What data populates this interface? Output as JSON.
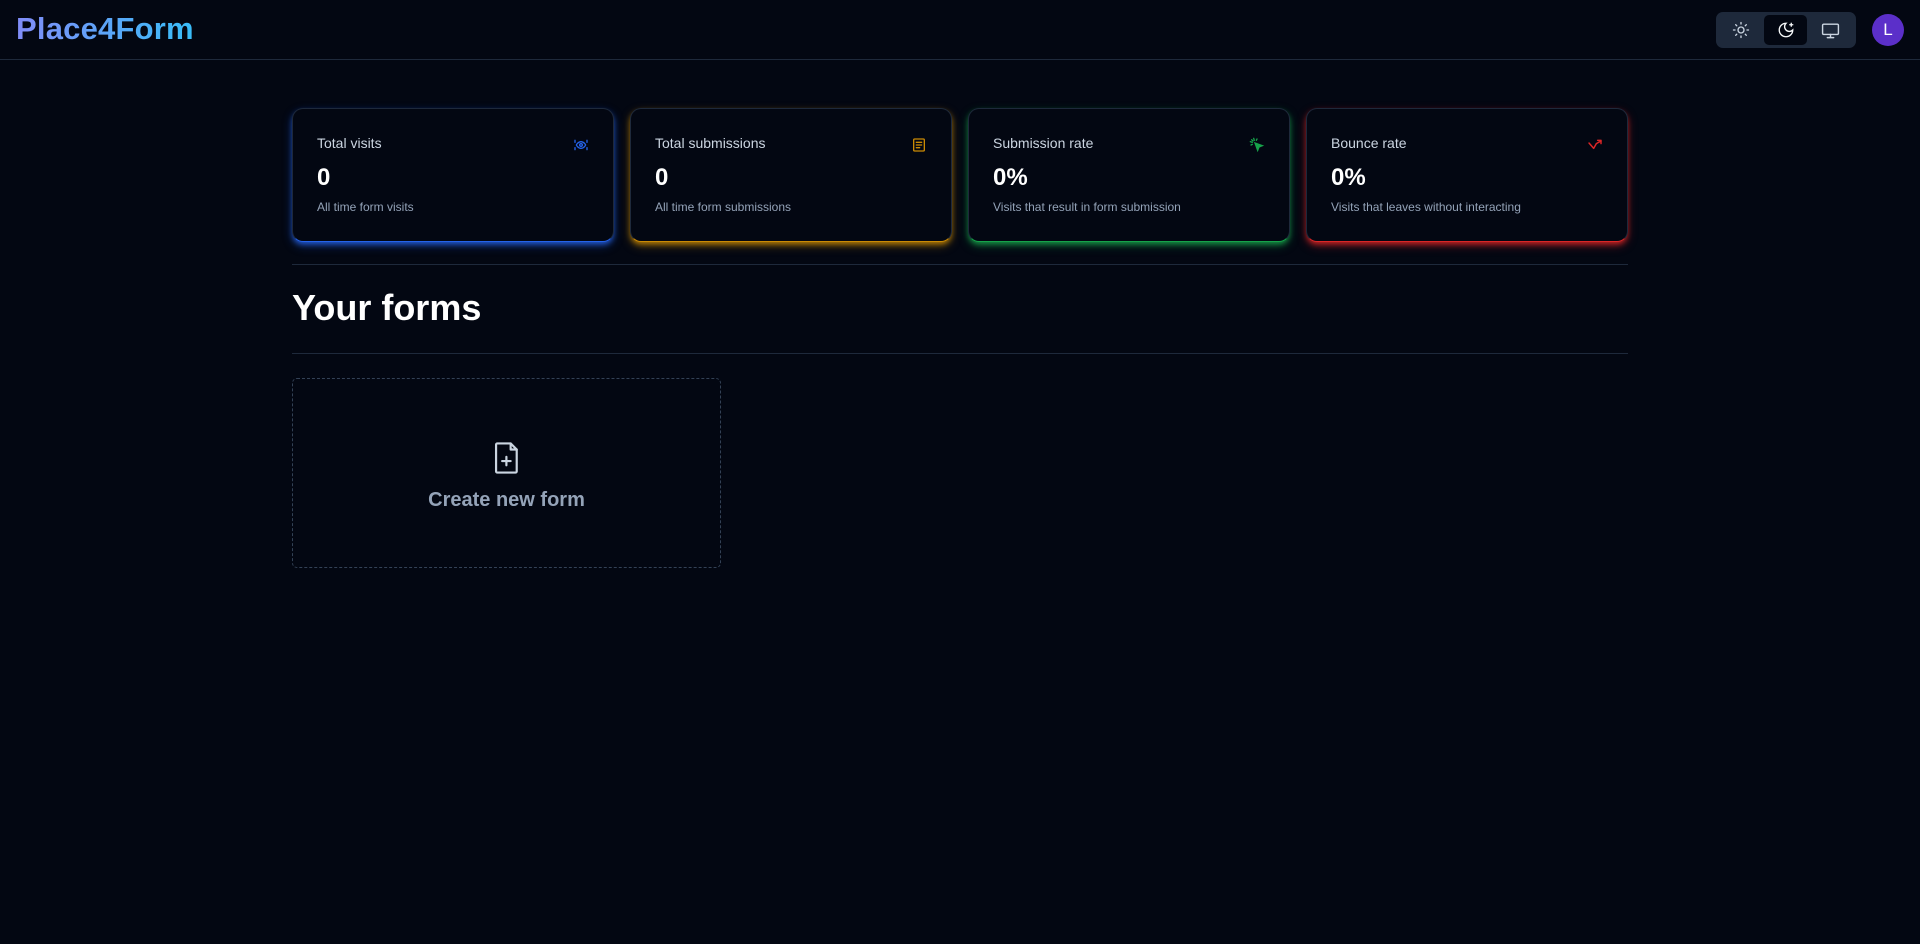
{
  "header": {
    "logo": "Place4Form",
    "theme_options": [
      {
        "name": "light",
        "icon": "sun-icon",
        "active": false
      },
      {
        "name": "dark",
        "icon": "moon-icon",
        "active": true
      },
      {
        "name": "system",
        "icon": "monitor-icon",
        "active": false
      }
    ],
    "avatar_initial": "L"
  },
  "stats": [
    {
      "title": "Total visits",
      "value": "0",
      "help": "All time form visits",
      "icon": "eye-icon",
      "color": "#2563eb"
    },
    {
      "title": "Total submissions",
      "value": "0",
      "help": "All time form submissions",
      "icon": "form-icon",
      "color": "#ca8a04"
    },
    {
      "title": "Submission rate",
      "value": "0%",
      "help": "Visits that result in form submission",
      "icon": "cursor-click-icon",
      "color": "#16a34a"
    },
    {
      "title": "Bounce rate",
      "value": "0%",
      "help": "Visits that leaves without interacting",
      "icon": "bounce-arrow-icon",
      "color": "#dc2626"
    }
  ],
  "forms_section": {
    "title": "Your forms",
    "create_label": "Create new form",
    "create_icon": "file-plus-icon"
  }
}
